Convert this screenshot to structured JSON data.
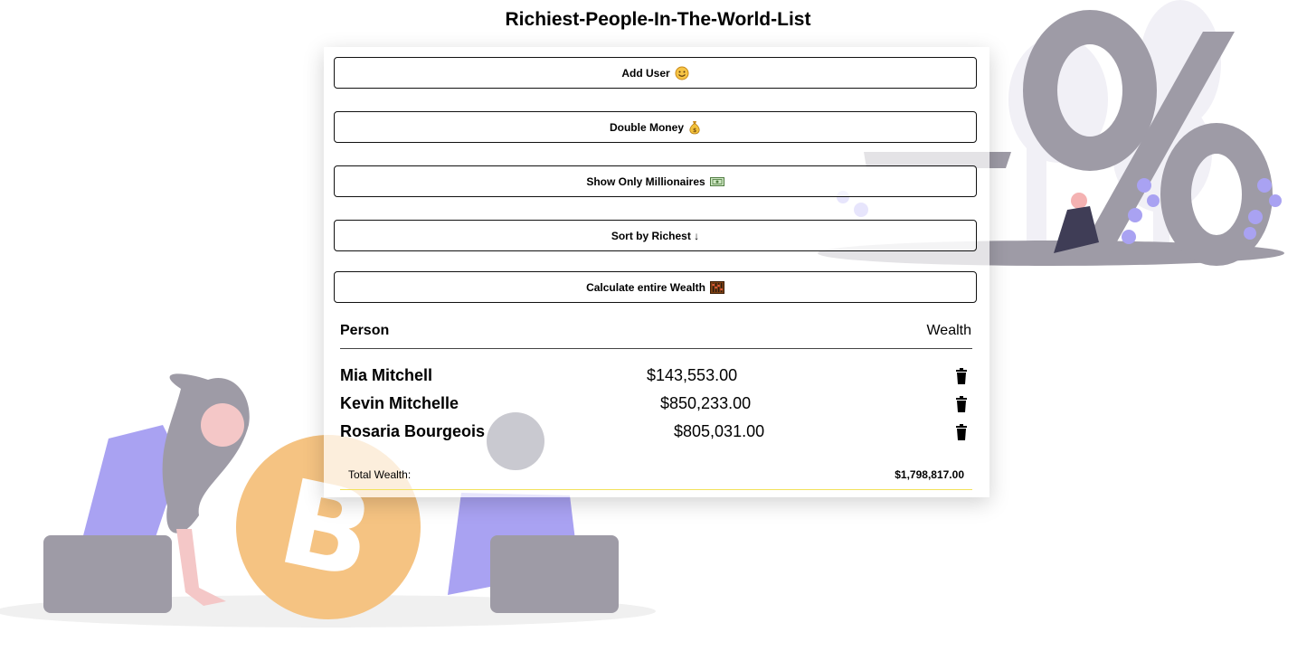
{
  "page": {
    "title": "Richiest-People-In-The-World-List"
  },
  "buttons": [
    {
      "label": "Add User",
      "icon": "smiley-face-icon"
    },
    {
      "label": "Double Money",
      "icon": "money-bag-icon"
    },
    {
      "label": "Show Only Millionaires",
      "icon": "banknote-icon"
    },
    {
      "label": "Sort by Richest ↓",
      "icon": ""
    },
    {
      "label": "Calculate entire Wealth",
      "icon": "abacus-icon"
    }
  ],
  "table": {
    "headers": {
      "person": "Person",
      "wealth": "Wealth"
    },
    "rows": [
      {
        "name": "Mia Mitchell",
        "wealth": "$143,553.00"
      },
      {
        "name": "Kevin Mitchelle",
        "wealth": "$850,233.00"
      },
      {
        "name": "Rosaria Bourgeois",
        "wealth": "$805,031.00"
      }
    ],
    "total_label": "Total Wealth:",
    "total_value": "$1,798,817.00"
  },
  "colors": {
    "illustration_gray": "#9e9ba6",
    "illustration_purple": "#a9a2f2",
    "bitcoin_orange": "#f5c382",
    "total_underline": "#f3e15b"
  }
}
